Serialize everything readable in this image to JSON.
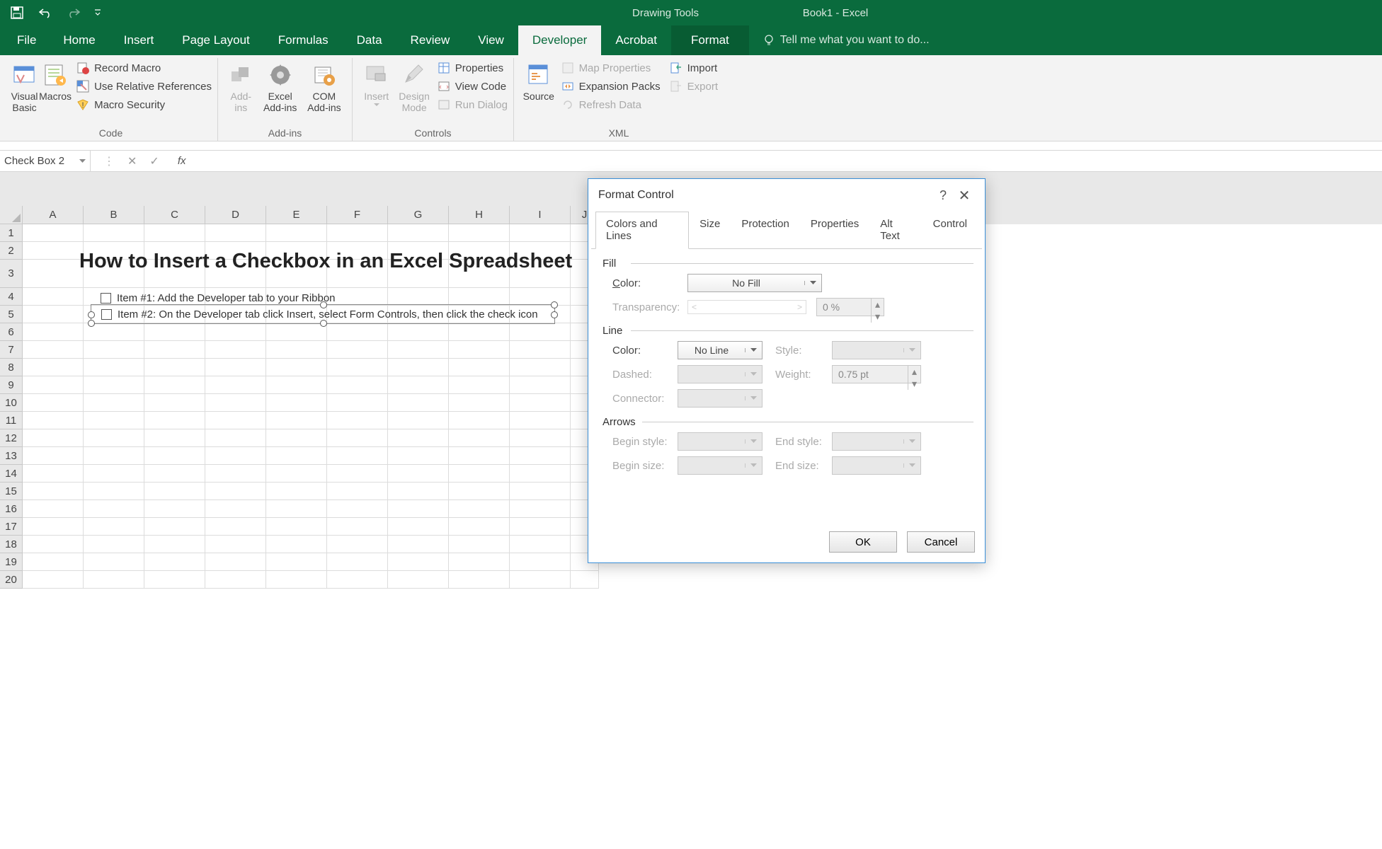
{
  "title_bar": {
    "drawing_tools": "Drawing Tools",
    "app_title": "Book1 - Excel"
  },
  "ribbon_tabs": [
    "File",
    "Home",
    "Insert",
    "Page Layout",
    "Formulas",
    "Data",
    "Review",
    "View",
    "Developer",
    "Acrobat",
    "Format"
  ],
  "active_tab": "Developer",
  "tellme": "Tell me what you want to do...",
  "ribbon_groups": {
    "code": {
      "visual_basic": "Visual\nBasic",
      "macros": "Macros",
      "record_macro": "Record Macro",
      "use_relative": "Use Relative References",
      "macro_security": "Macro Security",
      "label": "Code"
    },
    "addins": {
      "addins": "Add-\nins",
      "excel_addins": "Excel\nAdd-ins",
      "com_addins": "COM\nAdd-ins",
      "label": "Add-ins"
    },
    "controls": {
      "insert": "Insert",
      "design_mode": "Design\nMode",
      "properties": "Properties",
      "view_code": "View Code",
      "run_dialog": "Run Dialog",
      "label": "Controls"
    },
    "xml": {
      "source": "Source",
      "map_properties": "Map Properties",
      "expansion_packs": "Expansion Packs",
      "refresh_data": "Refresh Data",
      "import": "Import",
      "export": "Export",
      "label": "XML"
    }
  },
  "formula_bar": {
    "name_box": "Check Box 2",
    "fx": "fx"
  },
  "columns": [
    "A",
    "B",
    "C",
    "D",
    "E",
    "F",
    "G",
    "H",
    "I",
    "J"
  ],
  "rows_count": 20,
  "sheet": {
    "title": "How to Insert a Checkbox in an Excel Spreadsheet",
    "item1": "Item #1: Add the Developer tab to your Ribbon",
    "item2": "Item #2: On the Developer tab click Insert, select Form Controls, then click the check icon"
  },
  "dialog": {
    "title": "Format Control",
    "tabs": [
      "Colors and Lines",
      "Size",
      "Protection",
      "Properties",
      "Alt Text",
      "Control"
    ],
    "active_tab": "Colors and Lines",
    "fill": {
      "legend": "Fill",
      "color_label": "Color:",
      "color_value": "No Fill",
      "transparency_label": "Transparency:",
      "transparency_value": "0 %"
    },
    "line": {
      "legend": "Line",
      "color_label": "Color:",
      "color_value": "No Line",
      "style_label": "Style:",
      "dashed_label": "Dashed:",
      "weight_label": "Weight:",
      "weight_value": "0.75 pt",
      "connector_label": "Connector:"
    },
    "arrows": {
      "legend": "Arrows",
      "begin_style": "Begin style:",
      "end_style": "End style:",
      "begin_size": "Begin size:",
      "end_size": "End size:"
    },
    "ok": "OK",
    "cancel": "Cancel"
  }
}
